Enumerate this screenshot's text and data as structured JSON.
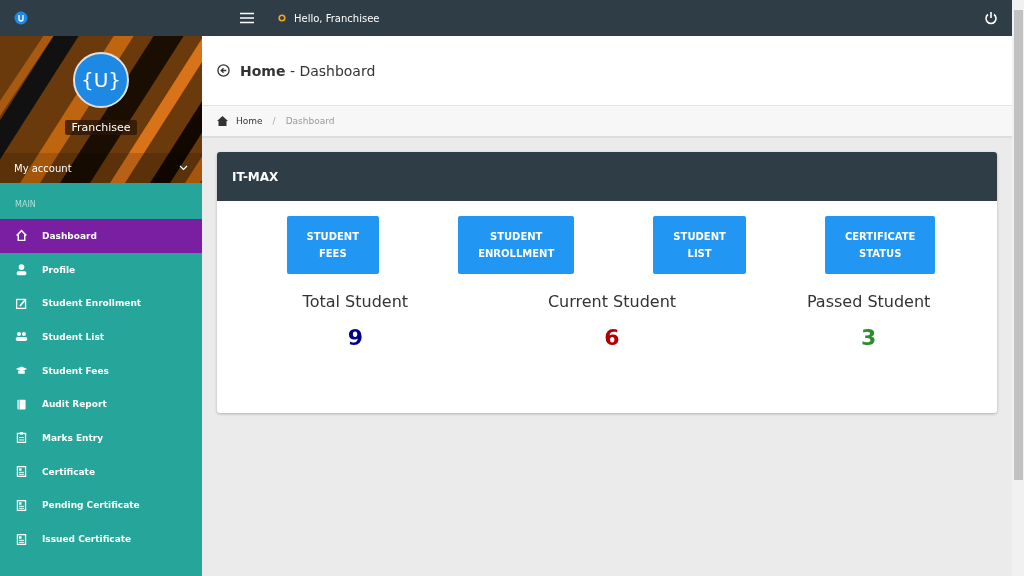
{
  "topbar": {
    "greeting": "Hello, Franchisee"
  },
  "sidebar": {
    "avatar_text": "{U}",
    "user": "Franchisee",
    "account": "My account",
    "section": "MAIN",
    "items": [
      {
        "label": "Dashboard",
        "kind": "home",
        "selected": true
      },
      {
        "label": "Profile",
        "kind": "user",
        "selected": false
      },
      {
        "label": "Student Enrollment",
        "kind": "edit",
        "selected": false
      },
      {
        "label": "Student List",
        "kind": "group",
        "selected": false
      },
      {
        "label": "Student Fees",
        "kind": "cap",
        "selected": false
      },
      {
        "label": "Audit Report",
        "kind": "book",
        "selected": false
      },
      {
        "label": "Marks Entry",
        "kind": "clipboard",
        "selected": false
      },
      {
        "label": "Certificate",
        "kind": "doc",
        "selected": false
      },
      {
        "label": "Pending Certificate",
        "kind": "doc",
        "selected": false
      },
      {
        "label": "Issued Certificate",
        "kind": "doc",
        "selected": false
      }
    ]
  },
  "header": {
    "title": "Home",
    "subtitle": "- Dashboard"
  },
  "breadcrumb": [
    "Home",
    "/",
    "Dashboard"
  ],
  "card": {
    "title": "IT-MAX",
    "buttons": [
      [
        "STUDENT",
        "FEES"
      ],
      [
        "STUDENT",
        "ENROLLMENT"
      ],
      [
        "STUDENT",
        "LIST"
      ],
      [
        "CERTIFICATE",
        "STATUS"
      ]
    ],
    "stats": [
      {
        "label": "Total Student",
        "value": "9",
        "color": "#00008b"
      },
      {
        "label": "Current Student",
        "value": "6",
        "color": "#b00000"
      },
      {
        "label": "Passed Student",
        "value": "3",
        "color": "#2e8b2e"
      }
    ]
  }
}
